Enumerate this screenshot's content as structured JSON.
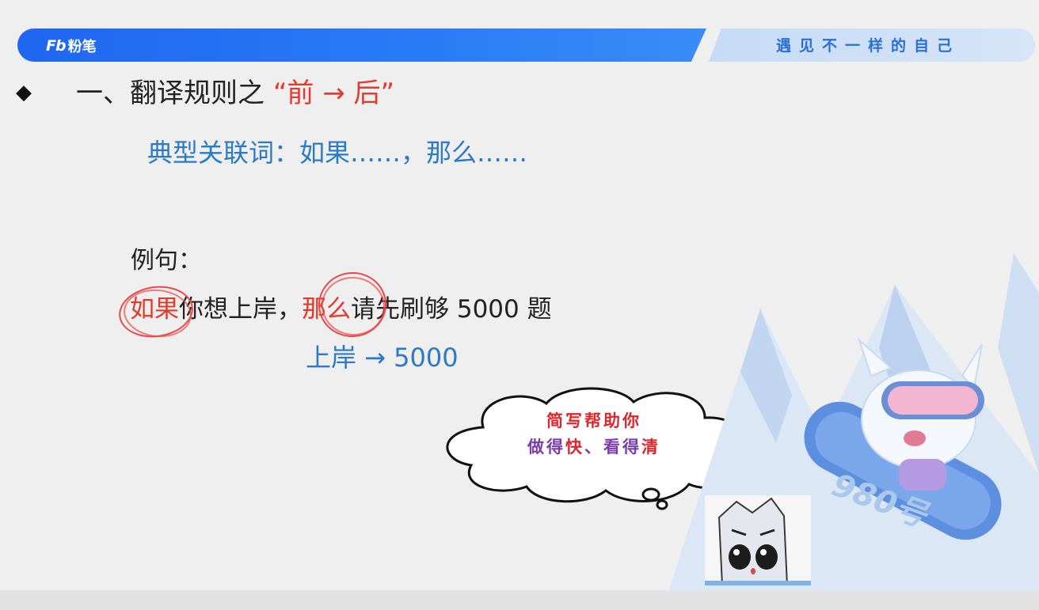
{
  "header": {
    "brand_mark": "Fb",
    "brand_name": "粉笔",
    "tagline": "遇见不一样的自己"
  },
  "title": {
    "bullet": "◆",
    "prefix": "一、翻译规则之",
    "highlight": "“前 → 后”"
  },
  "subtitle": "典型关联词：如果……，那么……",
  "example": {
    "label": "例句：",
    "w1": "如果",
    "mid": "你想上岸，",
    "w2": "那么",
    "rest": "请先刷够 5000 题",
    "notation": "上岸 → 5000"
  },
  "cloud": {
    "line1": "简写帮助你",
    "line2_a": "做得",
    "line2_b": "快",
    "line2_c": "、看得",
    "line2_d": "清"
  },
  "mascot": {
    "badge": "980号"
  },
  "colors": {
    "accent_blue": "#2a7ac6",
    "accent_red": "#e23a2c",
    "header_blue": "#1f66f0"
  }
}
